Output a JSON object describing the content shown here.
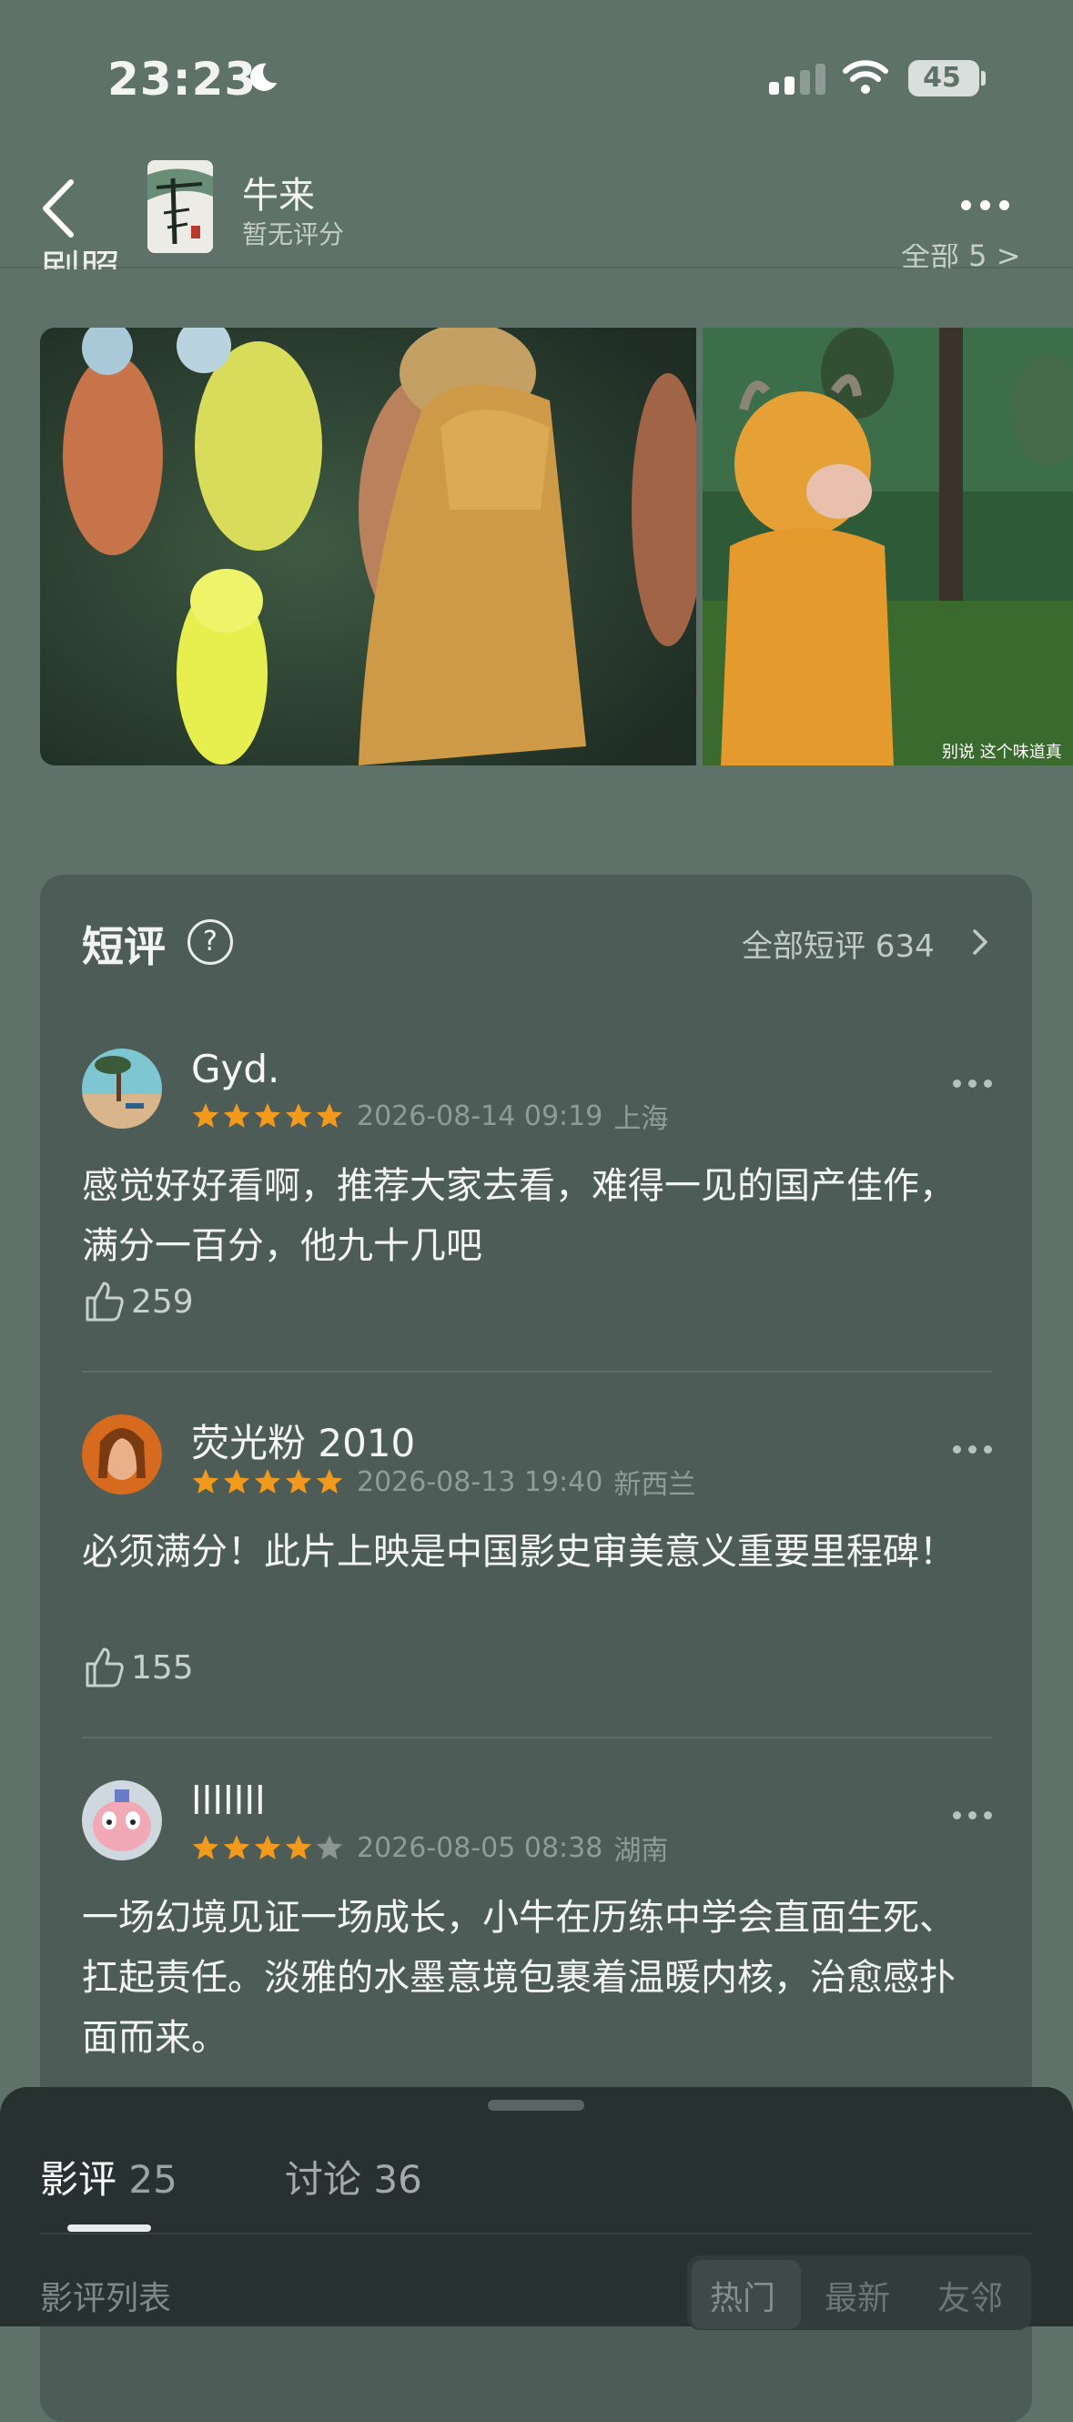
{
  "status_bar": {
    "time": "23:23",
    "battery": "45"
  },
  "header": {
    "title": "牛来",
    "subtitle": "暂无评分"
  },
  "stills": {
    "heading": "剧照",
    "all_label": "全部 5 >",
    "caption": "别说 这个味道真"
  },
  "short_reviews": {
    "title": "短评",
    "help": "?",
    "all_label": "全部短评 634",
    "items": [
      {
        "user": "Gyd.",
        "rating": 5,
        "date": "2026-08-14 09:19",
        "location": "上海",
        "text": "感觉好好看啊，推荐大家去看，难得一见的国产佳作，满分一百分，他九十几吧",
        "likes": "259"
      },
      {
        "user": "荧光粉 2010",
        "rating": 5,
        "date": "2026-08-13 19:40",
        "location": "新西兰",
        "text": "必须满分！此片上映是中国影史审美意义重要里程碑！",
        "likes": "155"
      },
      {
        "user": "lllllll",
        "rating": 4,
        "date": "2026-08-05 08:38",
        "location": "湖南",
        "text": "一场幻境见证一场成长，小牛在历练中学会直面生死、扛起责任。淡雅的水墨意境包裹着温暖内核，治愈感扑面而来。",
        "likes": ""
      }
    ]
  },
  "bottom_sheet": {
    "tabs": [
      {
        "label": "影评",
        "count": "25"
      },
      {
        "label": "讨论",
        "count": "36"
      }
    ],
    "list_label": "影评列表",
    "sort_options": [
      "热门",
      "最新",
      "友邻"
    ]
  },
  "colors": {
    "background": "#5f726a",
    "card": "#4e5c57",
    "star": "#f39a1d",
    "sheet": "#273130"
  }
}
